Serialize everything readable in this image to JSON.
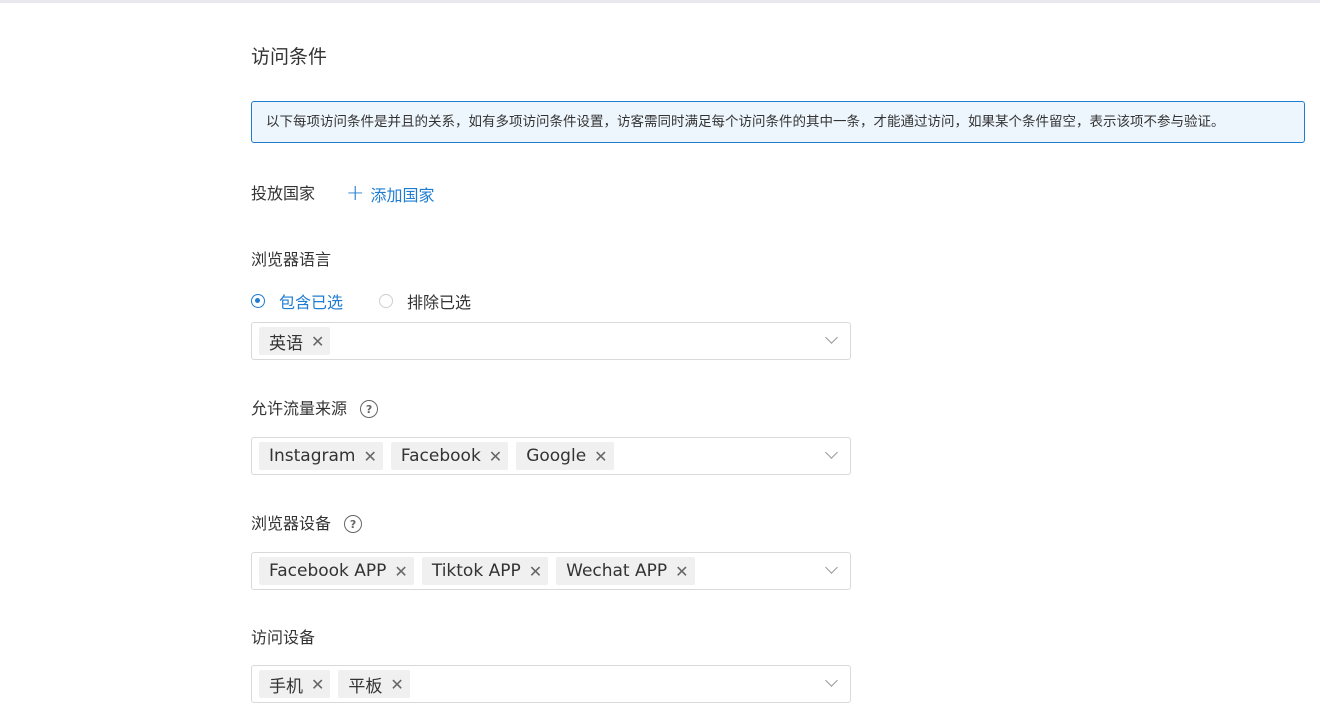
{
  "section_title": "访问条件",
  "notice": "以下每项访问条件是并且的关系，如有多项访问条件设置，访客需同时满足每个访问条件的其中一条，才能通过访问，如果某个条件留空，表示该项不参与验证。",
  "country": {
    "label": "投放国家",
    "add_label": "添加国家"
  },
  "browser_language": {
    "label": "浏览器语言",
    "radio_include": "包含已选",
    "radio_exclude": "排除已选",
    "tags": [
      "英语"
    ]
  },
  "traffic_source": {
    "label": "允许流量来源",
    "tags": [
      "Instagram",
      "Facebook",
      "Google"
    ]
  },
  "browser_device": {
    "label": "浏览器设备",
    "tags": [
      "Facebook APP",
      "Tiktok APP",
      "Wechat APP"
    ]
  },
  "access_device": {
    "label": "访问设备",
    "tags": [
      "手机",
      "平板"
    ]
  },
  "help_glyph": "?",
  "colors": {
    "accent": "#1f7dd1",
    "notice_bg": "#eef6fd",
    "tag_bg": "#f0f0f0"
  }
}
